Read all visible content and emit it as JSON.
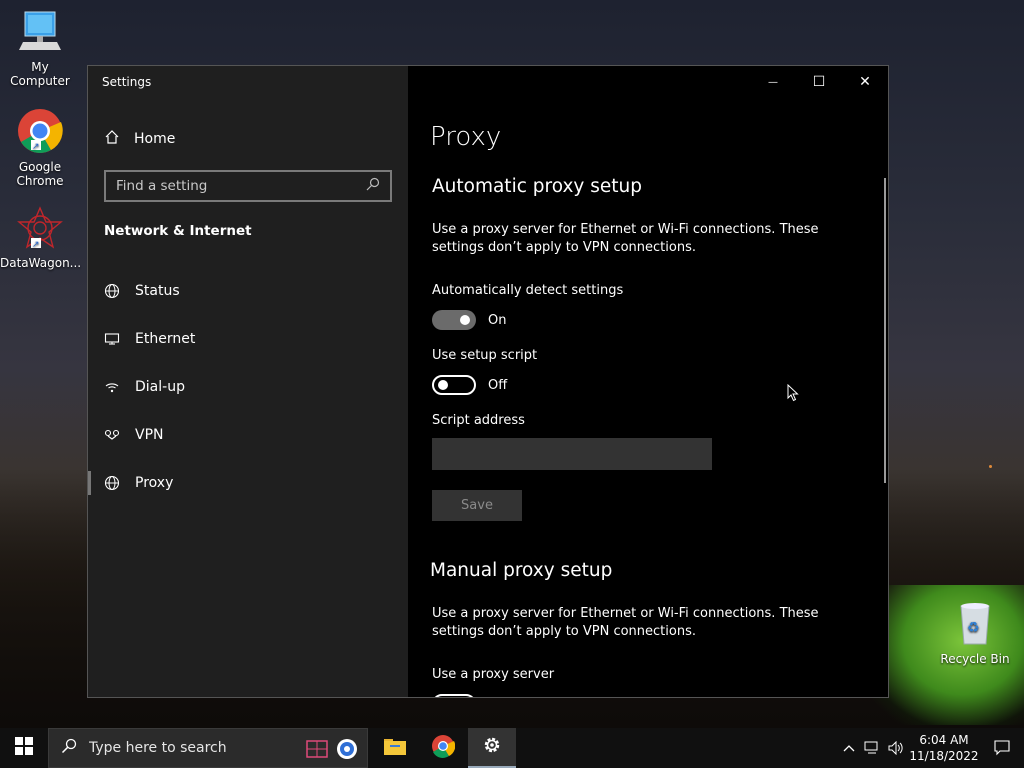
{
  "desktop": {
    "icons": [
      {
        "label": "My Computer"
      },
      {
        "label": "Google Chrome"
      },
      {
        "label": "DataWagon..."
      },
      {
        "label": "Recycle Bin"
      }
    ]
  },
  "window": {
    "title": "Settings",
    "controls": {
      "minimize": "—",
      "maximize": "☐",
      "close": "✕"
    }
  },
  "sidebar": {
    "home_label": "Home",
    "search_placeholder": "Find a setting",
    "section_title": "Network & Internet",
    "items": [
      {
        "label": "Status",
        "icon": "globe-status-icon"
      },
      {
        "label": "Ethernet",
        "icon": "ethernet-icon"
      },
      {
        "label": "Dial-up",
        "icon": "dialup-icon"
      },
      {
        "label": "VPN",
        "icon": "vpn-icon"
      },
      {
        "label": "Proxy",
        "icon": "globe-icon",
        "active": true
      }
    ]
  },
  "content": {
    "page_title": "Proxy",
    "automatic": {
      "heading": "Automatic proxy setup",
      "description": "Use a proxy server for Ethernet or Wi-Fi connections. These settings don’t apply to VPN connections.",
      "auto_detect_label": "Automatically detect settings",
      "auto_detect_state": "On",
      "setup_script_label": "Use setup script",
      "setup_script_state": "Off",
      "script_address_label": "Script address",
      "script_address_value": "",
      "save_label": "Save"
    },
    "manual": {
      "heading": "Manual proxy setup",
      "description": "Use a proxy server for Ethernet or Wi-Fi connections. These settings don’t apply to VPN connections.",
      "use_proxy_label": "Use a proxy server"
    }
  },
  "taskbar": {
    "search_placeholder": "Type here to search",
    "time": "6:04 AM",
    "date": "11/18/2022"
  },
  "colors": {
    "sidebar_bg": "#1f1f1f",
    "content_bg": "#000000",
    "toggle_on": "#6b6b6b",
    "taskbar_bg": "#101010"
  }
}
